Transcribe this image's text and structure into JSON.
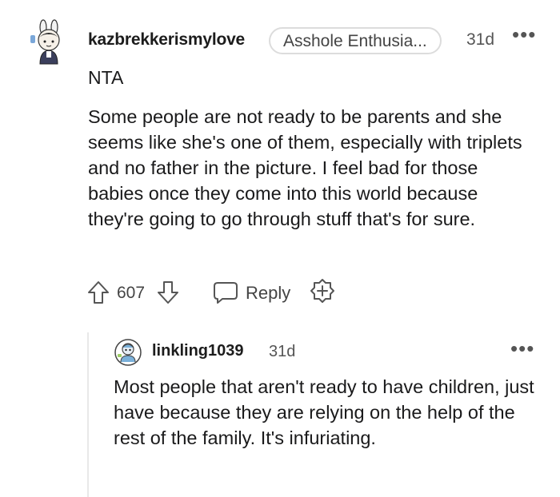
{
  "comment": {
    "username": "kazbrekkerismylove",
    "flair": "Asshole Enthusia...",
    "time": "31d",
    "more": "•••",
    "verdict": "NTA",
    "body": "Some people are not ready to be parents and she seems like she's one of them, especially with triplets and no father in the picture. I feel bad for those babies once they come into this world because they're going to go through stuff that's for sure.",
    "score": "607",
    "reply_label": "Reply"
  },
  "reply": {
    "username": "linkling1039",
    "time": "31d",
    "more": "•••",
    "body": "Most people that aren't ready to have children, just have because they are relying on the help of the rest of the family. It's infuriating."
  },
  "colors": {
    "text": "#1a1a1b",
    "muted": "#555555",
    "icon_stroke": "#555555",
    "flair_border": "#dcdcdc",
    "thread_line": "#e8e8e8"
  },
  "icons": [
    "user-avatar-icon",
    "upvote-arrow-icon",
    "downvote-arrow-icon",
    "comment-bubble-icon",
    "award-plus-icon",
    "more-options-icon"
  ]
}
